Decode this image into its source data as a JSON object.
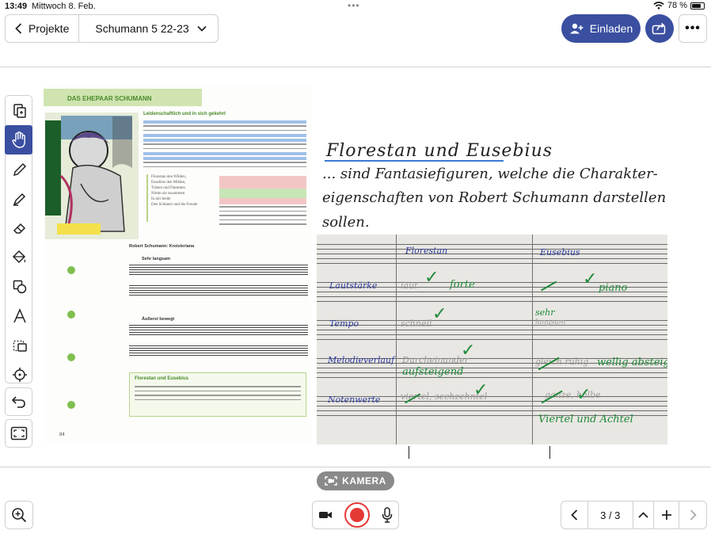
{
  "status": {
    "time": "13:49",
    "date": "Mittwoch 8. Feb.",
    "battery": "78 %",
    "battery_level": 0.78
  },
  "topbar": {
    "back_label": "Projekte",
    "project_title": "Schumann 5 22-23",
    "invite_label": "Einladen"
  },
  "camera": {
    "label": "KAMERA"
  },
  "pager": {
    "page_indicator": "3 / 3"
  },
  "book": {
    "header": "DAS EHEPAAR SCHUMANN",
    "para_title": "Leidenschaftlich und in sich gekehrt",
    "poem": [
      "Florestan den Wilden,",
      "Eusebius den Milden,",
      "Tränen und Flammen",
      "Nimm sie zusammen",
      "In mir beide",
      "Den Schmerz und die Freude"
    ],
    "score_title": "Robert Schumann: Kreisleriana",
    "tempo1": "Sehr langsam",
    "tempo2": "Äußerst bewegt",
    "infobox_title": "Florestan und Eusebius",
    "page_number": "84"
  },
  "handwriting": {
    "title": "Florestan und Eusebius",
    "line1": "... sind Fantasiefiguren, welche die Charakter-",
    "line2": "eigenschaften von Robert Schumann darstellen",
    "line3": "sollen."
  },
  "photo": {
    "col1": "Florestan",
    "col2": "Eusebius",
    "row1": "Lautstärke",
    "row2": "Tempo",
    "row3": "Melodieverlauf",
    "row4": "Notenwerte",
    "r1c1_grey": "laut",
    "r1c1_green": "forte",
    "r1c2_green": "piano",
    "r2c1_grey": "schnell",
    "r2c2_green": "sehr",
    "r2c2_grey": "langsam",
    "r3c1_grey": "Durcheinander",
    "r3c1_green": "aufsteigend",
    "r3c2_grey": "gleich ruhig",
    "r3c2_green": "wellig absteigend",
    "r4c1_grey": "viertel, sechzehntel",
    "r4c2_grey": "ganze, halbe",
    "r4c2_green": "Viertel und Achtel"
  }
}
